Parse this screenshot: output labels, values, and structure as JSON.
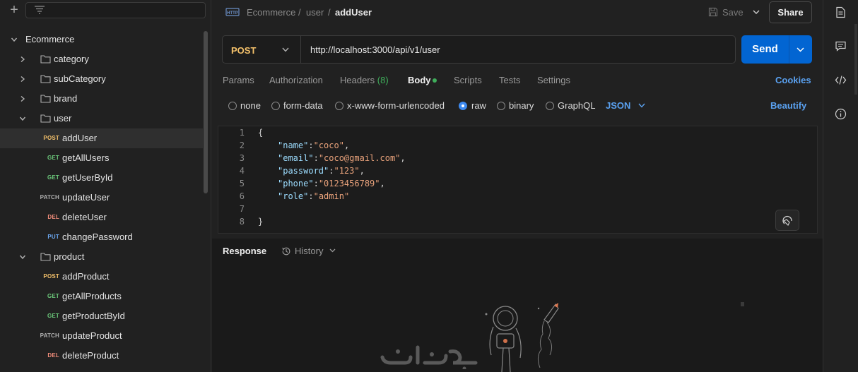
{
  "sidebar": {
    "collection": "Ecommerce",
    "items": [
      {
        "type": "folder",
        "label": "category",
        "expanded": false
      },
      {
        "type": "folder",
        "label": "subCategory",
        "expanded": false
      },
      {
        "type": "folder",
        "label": "brand",
        "expanded": false
      },
      {
        "type": "folder",
        "label": "user",
        "expanded": true
      },
      {
        "type": "request",
        "method": "POST",
        "label": "addUser",
        "selected": true
      },
      {
        "type": "request",
        "method": "GET",
        "label": "getAllUsers"
      },
      {
        "type": "request",
        "method": "GET",
        "label": "getUserById"
      },
      {
        "type": "request",
        "method": "PATCH",
        "label": "updateUser"
      },
      {
        "type": "request",
        "method": "DEL",
        "label": "deleteUser"
      },
      {
        "type": "request",
        "method": "PUT",
        "label": "changePassword"
      },
      {
        "type": "folder",
        "label": "product",
        "expanded": true
      },
      {
        "type": "request",
        "method": "POST",
        "label": "addProduct"
      },
      {
        "type": "request",
        "method": "GET",
        "label": "getAllProducts"
      },
      {
        "type": "request",
        "method": "GET",
        "label": "getProductById"
      },
      {
        "type": "request",
        "method": "PATCH",
        "label": "updateProduct"
      },
      {
        "type": "request",
        "method": "DEL",
        "label": "deleteProduct"
      }
    ]
  },
  "header": {
    "breadcrumb": [
      "Ecommerce",
      "user"
    ],
    "separator": "/",
    "request_name": "addUser",
    "save_label": "Save",
    "share_label": "Share"
  },
  "request": {
    "method": "POST",
    "url": "http://localhost:3000/api/v1/user",
    "send_label": "Send"
  },
  "tabs": {
    "params": "Params",
    "authorization": "Authorization",
    "headers": "Headers",
    "headers_count": "(8)",
    "body": "Body",
    "scripts": "Scripts",
    "tests": "Tests",
    "settings": "Settings",
    "cookies": "Cookies"
  },
  "body_options": {
    "none": "none",
    "form_data": "form-data",
    "urlencoded": "x-www-form-urlencoded",
    "raw": "raw",
    "binary": "binary",
    "graphql": "GraphQL",
    "selected": "raw",
    "language": "JSON",
    "beautify": "Beautify"
  },
  "editor": {
    "line_numbers": [
      "1",
      "2",
      "3",
      "4",
      "5",
      "6",
      "7",
      "8"
    ],
    "open_brace": "{",
    "close_brace": "}",
    "fields": [
      {
        "key": "\"name\"",
        "value": "\"coco\"",
        "trail": ","
      },
      {
        "key": "\"email\"",
        "value": "\"coco@gmail.com\"",
        "trail": ","
      },
      {
        "key": "\"password\"",
        "value": "\"123\"",
        "trail": ","
      },
      {
        "key": "\"phone\"",
        "value": "\"0123456789\"",
        "trail": ","
      },
      {
        "key": "\"role\"",
        "value": "\"admin\"",
        "trail": ""
      }
    ]
  },
  "response": {
    "label": "Response",
    "history_label": "History"
  },
  "colors": {
    "accent": "#0265d2",
    "link": "#5aa1f0",
    "post": "#f5c26b",
    "get": "#6bc77a",
    "delete": "#f08c7a",
    "put": "#6ba7f0"
  },
  "icons": [
    "plus-icon",
    "filter-icon",
    "chevron-right-icon",
    "chevron-down-icon",
    "folder-icon",
    "http-icon",
    "save-icon",
    "history-icon",
    "documentation-icon",
    "comments-icon",
    "code-icon",
    "info-icon",
    "beautify-icon"
  ]
}
